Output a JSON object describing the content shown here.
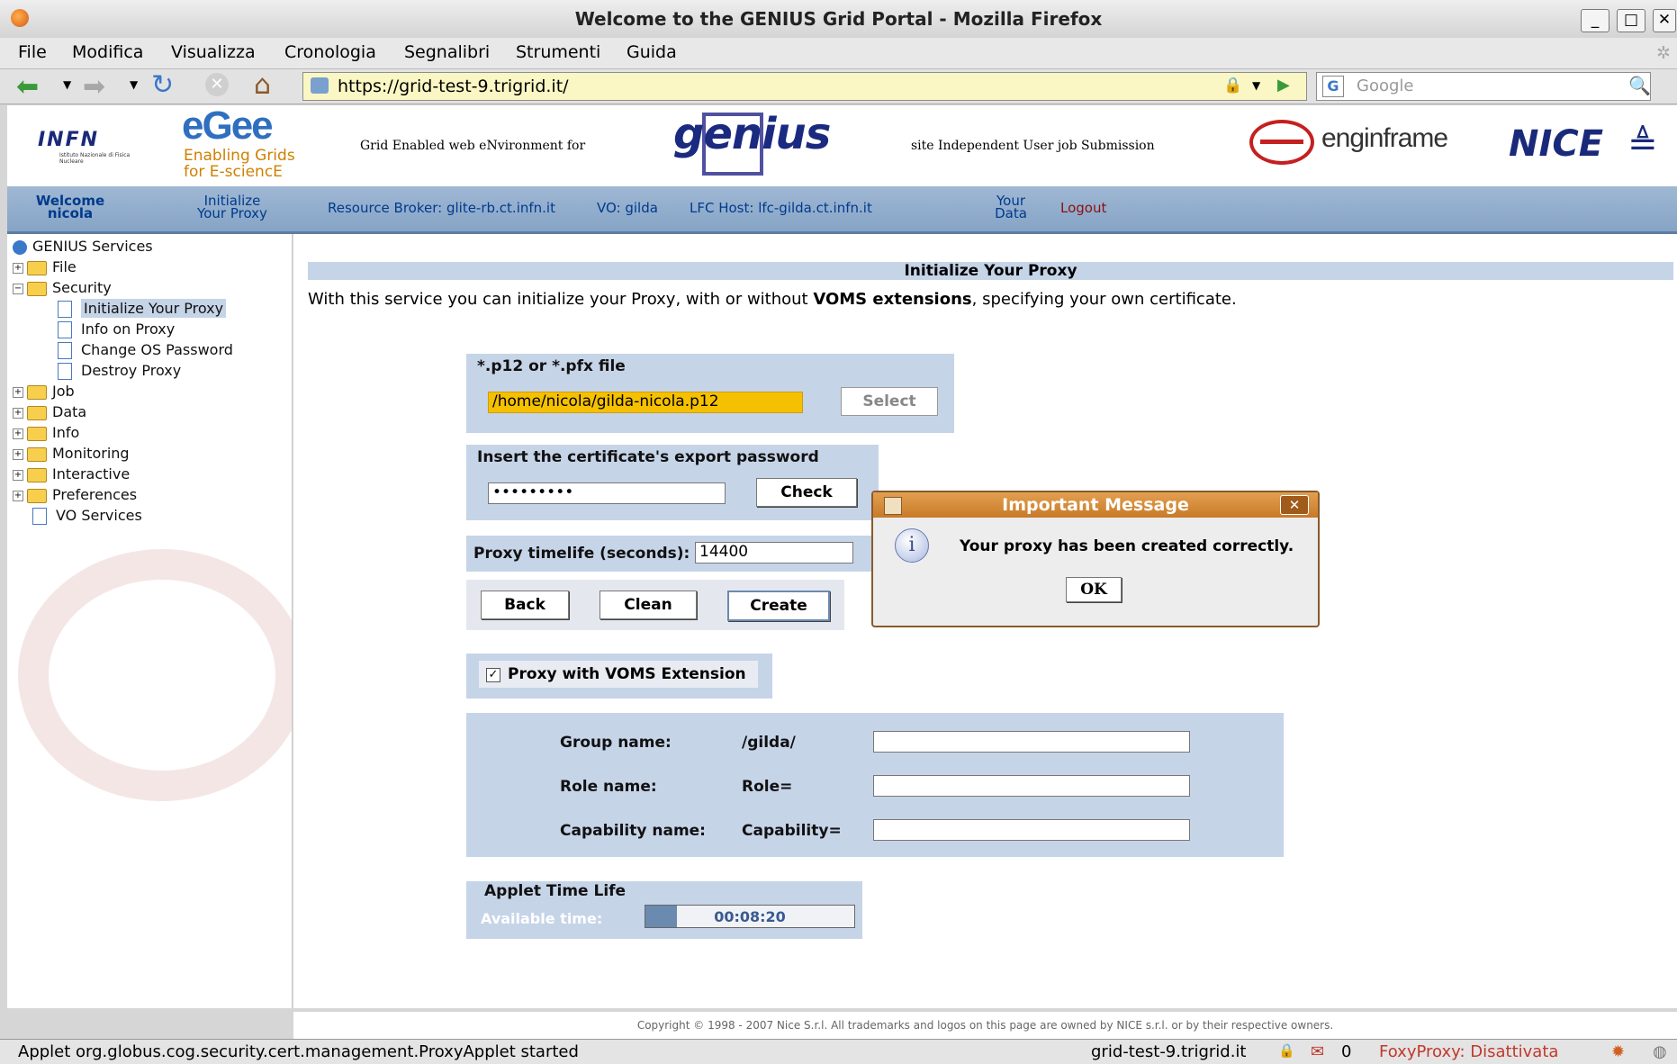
{
  "window": {
    "title": "Welcome to the GENIUS Grid Portal - Mozilla Firefox"
  },
  "menu": [
    "File",
    "Modifica",
    "Visualizza",
    "Cronologia",
    "Segnalibri",
    "Strumenti",
    "Guida"
  ],
  "navbar": {
    "url": "https://grid-test-9.trigrid.it/",
    "search_placeholder": "Google"
  },
  "logos": {
    "infn": "INFN",
    "infn_sub": "Istituto Nazionale di Fisica Nucleare",
    "egee": "eGee",
    "egee_sub1": "Enabling Grids",
    "egee_sub2": "for E-sciencE",
    "genius_left": "Grid Enabled web eNvironment for",
    "genius": "genius",
    "genius_right": "site Independent User job Submission",
    "enginframe": "enginframe",
    "nice": "NICE"
  },
  "bluenav": {
    "welcome": "Welcome",
    "user": "nicola",
    "init1": "Initialize",
    "init2": "Your Proxy",
    "rb": "Resource Broker: glite-rb.ct.infn.it",
    "vo": "VO: gilda",
    "lfc": "LFC Host: lfc-gilda.ct.infn.it",
    "your": "Your",
    "data": "Data",
    "logout": "Logout"
  },
  "sidebar": {
    "root": "GENIUS Services",
    "items": {
      "file": "File",
      "security": "Security",
      "init": "Initialize Your Proxy",
      "info_proxy": "Info on Proxy",
      "change_pw": "Change OS Password",
      "destroy": "Destroy Proxy",
      "job": "Job",
      "data": "Data",
      "info": "Info",
      "monitoring": "Monitoring",
      "interactive": "Interactive",
      "preferences": "Preferences",
      "vo_services": "VO Services"
    }
  },
  "main": {
    "heading": "Initialize Your Proxy",
    "intro_pre": "With this service you can initialize your Proxy, with or without ",
    "intro_bold": "VOMS extensions",
    "intro_post": ", specifying your own certificate.",
    "file_label": "*.p12 or *.pfx file",
    "file_value": "/home/nicola/gilda-nicola.p12",
    "select": "Select",
    "pw_label": "Insert the certificate's export password",
    "pw_value": "•••••••••",
    "check": "Check",
    "timelife_label": "Proxy timelife (seconds):",
    "timelife_value": "14400",
    "back": "Back",
    "clean": "Clean",
    "create": "Create",
    "voms_label": "Proxy with VOMS Extension",
    "group_label": "Group name:",
    "group_prefix": "/gilda/",
    "role_label": "Role name:",
    "role_prefix": "Role=",
    "cap_label": "Capability name:",
    "cap_prefix": "Capability=",
    "applet_label": "Applet Time Life",
    "available": "Available time:",
    "time": "00:08:20",
    "time_fill": 0.15
  },
  "dialog": {
    "title": "Important Message",
    "message": "Your proxy has been created correctly.",
    "ok": "OK"
  },
  "copyright": "Copyright © 1998 - 2007 Nice S.r.l. All trademarks and logos on this page are owned by NICE s.r.l. or by their respective owners.",
  "statusbar": {
    "message": "Applet org.globus.cog.security.cert.management.ProxyApplet started",
    "host": "grid-test-9.trigrid.it",
    "mail": "0",
    "foxy": "FoxyProxy: Disattivata"
  },
  "colors": {
    "accent_blue": "#86a4c6",
    "panel": "#c6d4e8",
    "file_highlight": "#f5c000",
    "foxy": "#c0392b"
  }
}
